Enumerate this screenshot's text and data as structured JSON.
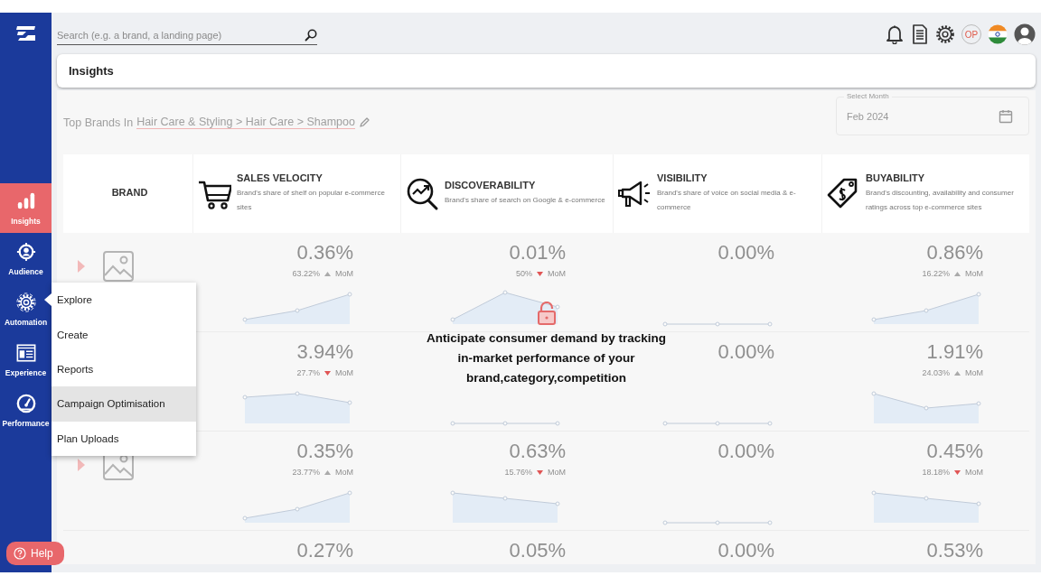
{
  "sidebar": {
    "items": [
      {
        "label": "Insights",
        "selected": true
      },
      {
        "label": "Audience",
        "selected": false
      },
      {
        "label": "Automation",
        "selected": false,
        "flyout": [
          {
            "label": "Explore",
            "selected": false
          },
          {
            "label": "Create",
            "selected": false
          },
          {
            "label": "Reports",
            "selected": false
          },
          {
            "label": "Campaign Optimisation",
            "selected": true
          },
          {
            "label": "Plan Uploads",
            "selected": false
          }
        ]
      },
      {
        "label": "Experience",
        "selected": false
      },
      {
        "label": "Performance",
        "selected": false
      }
    ]
  },
  "help": {
    "label": "Help"
  },
  "search": {
    "placeholder": "Search (e.g. a brand, a landing page)"
  },
  "toolbar": [
    {
      "kind": "bell"
    },
    {
      "kind": "document"
    },
    {
      "kind": "settings"
    },
    {
      "kind": "badge",
      "label": "OP"
    },
    {
      "kind": "flag"
    },
    {
      "kind": "avatar"
    }
  ],
  "page_title": "Insights",
  "heading": {
    "prefix": "Top Brands In",
    "link": "Hair Care & Styling > Hair Care > Shampoo"
  },
  "month_picker": {
    "label": "Select Month",
    "value": "Feb 2024"
  },
  "table": {
    "locked": true,
    "lock_message": "Anticipate consumer demand by tracking in-market performance of your brand,category,competition",
    "columns": [
      {
        "title": "BRAND"
      },
      {
        "title": "SALES VELOCITY",
        "description": "Brand's share of shelf on popular e-commerce sites"
      },
      {
        "title": "DISCOVERABILITY",
        "description": "Brand's share of search on Google & e-commerce"
      },
      {
        "title": "VISIBILITY",
        "description": "Brand's share of voice on social media & e-commerce"
      },
      {
        "title": "BUYABILITY",
        "description": "Brand's discounting, availability and consumer ratings across top e-commerce sites"
      }
    ],
    "rows": [
      {
        "cells": [
          {
            "expandable": true
          },
          {
            "value": "0.36%",
            "change": "63.22%",
            "trend_up": true,
            "period": "MoM"
          },
          {
            "value": "0.01%",
            "change": "50%",
            "trend_up": false,
            "period": "MoM"
          },
          {
            "value": "0.00%"
          },
          {
            "value": "0.86%",
            "change": "16.22%",
            "trend_up": true,
            "period": "MoM"
          }
        ]
      },
      {
        "cells": [
          "",
          {
            "value": "3.94%",
            "change": "27.7%",
            "trend_up": false,
            "period": "MoM"
          },
          "",
          {
            "value": "0.00%"
          },
          {
            "value": "1.91%",
            "change": "24.03%",
            "trend_up": true,
            "period": "MoM"
          }
        ]
      },
      {
        "cells": [
          {
            "expandable": true
          },
          {
            "value": "0.35%",
            "change": "23.77%",
            "trend_up": true,
            "period": "MoM"
          },
          {
            "value": "0.63%",
            "change": "15.76%",
            "trend_up": false,
            "period": "MoM"
          },
          {
            "value": "0.00%"
          },
          {
            "value": "0.45%",
            "change": "18.18%",
            "trend_up": false,
            "period": "MoM"
          }
        ]
      },
      {
        "cells": [
          "",
          {
            "value": "0.27%"
          },
          {
            "value": "0.05%"
          },
          {
            "value": "0.00%"
          },
          {
            "value": "0.53%"
          }
        ]
      }
    ]
  }
}
